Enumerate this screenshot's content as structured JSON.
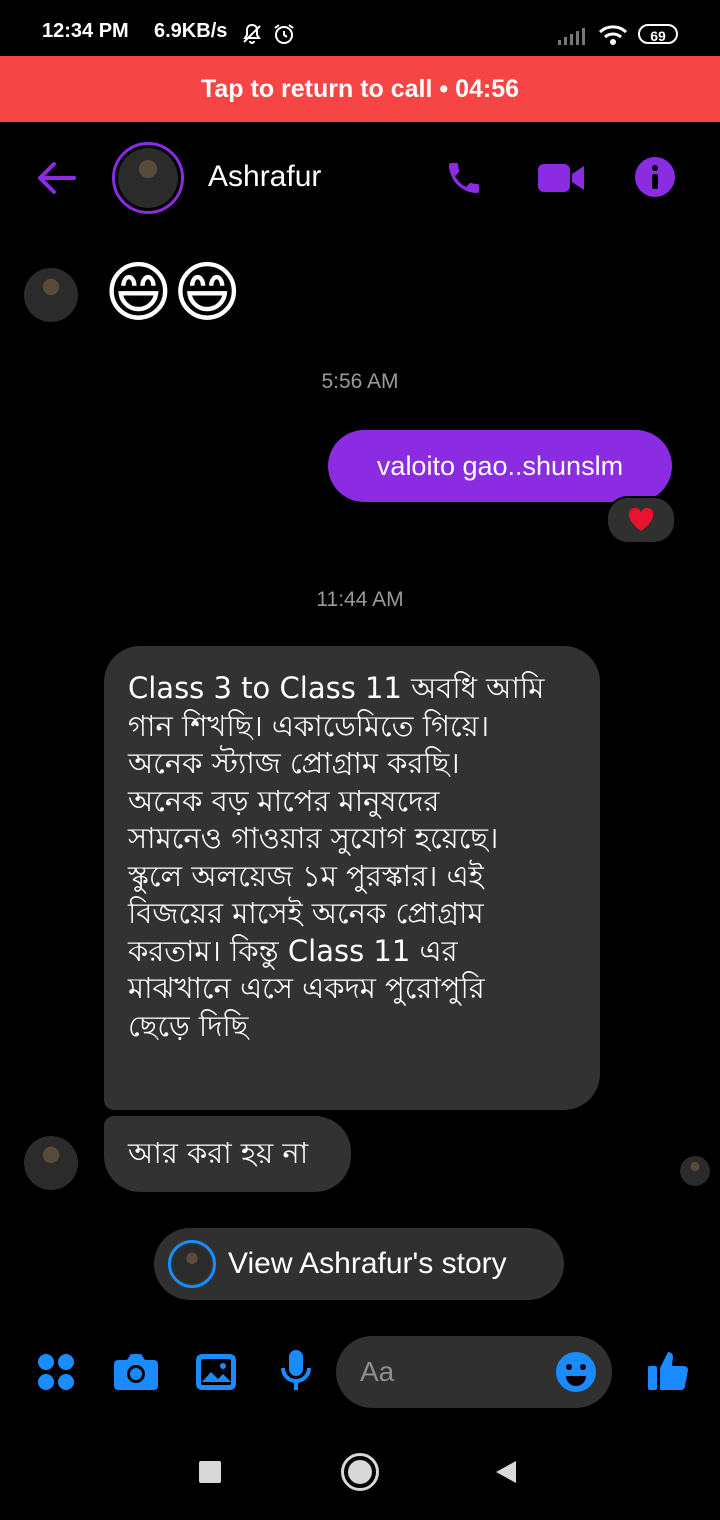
{
  "status_bar": {
    "time": "12:34 PM",
    "speed": "6.9KB/s",
    "battery": "69"
  },
  "call_banner": {
    "text": "Tap to return to call • 04:56"
  },
  "header": {
    "contact_name": "Ashrafur"
  },
  "messages": {
    "emoji": "😄😄",
    "timestamp_1": "5:56 AM",
    "outgoing_1": "valoito gao..shunslm",
    "reaction_1": "❤️",
    "timestamp_2": "11:44 AM",
    "incoming_1": "Class 3 to Class 11 অবধি আমি\nগান শিখছি। একাডেমিতে গিয়ে।\nঅনেক স্ট্যাজ প্রোগ্রাম করছি।\nঅনেক বড় মাপের মানুষদের\nসামনেও গাওয়ার সুযোগ হয়েছে।\nস্কুলে অলয়েজ ১ম পুরস্কার। এই\nবিজয়ের মাসেই অনেক প্রোগ্রাম\nকরতাম। কিন্তু Class 11 এর\nমাঝখানে এসে একদম পুরোপুরি\nছেড়ে দিছি",
    "incoming_2": "আর করা হয় না"
  },
  "story": {
    "label": "View Ashrafur's story"
  },
  "composer": {
    "placeholder": "Aa"
  },
  "colors": {
    "accent_purple": "#8b2be2",
    "call_banner_red": "#f54544",
    "composer_blue": "#1a8cff",
    "bubble_incoming": "#323232"
  },
  "icons": {
    "back": "arrow-left-icon",
    "call": "phone-icon",
    "video": "video-camera-icon",
    "info": "info-icon",
    "apps": "four-dots-icon",
    "camera": "camera-icon",
    "gallery": "image-icon",
    "mic": "microphone-icon",
    "emoji": "smiley-icon",
    "like": "thumbs-up-icon"
  }
}
